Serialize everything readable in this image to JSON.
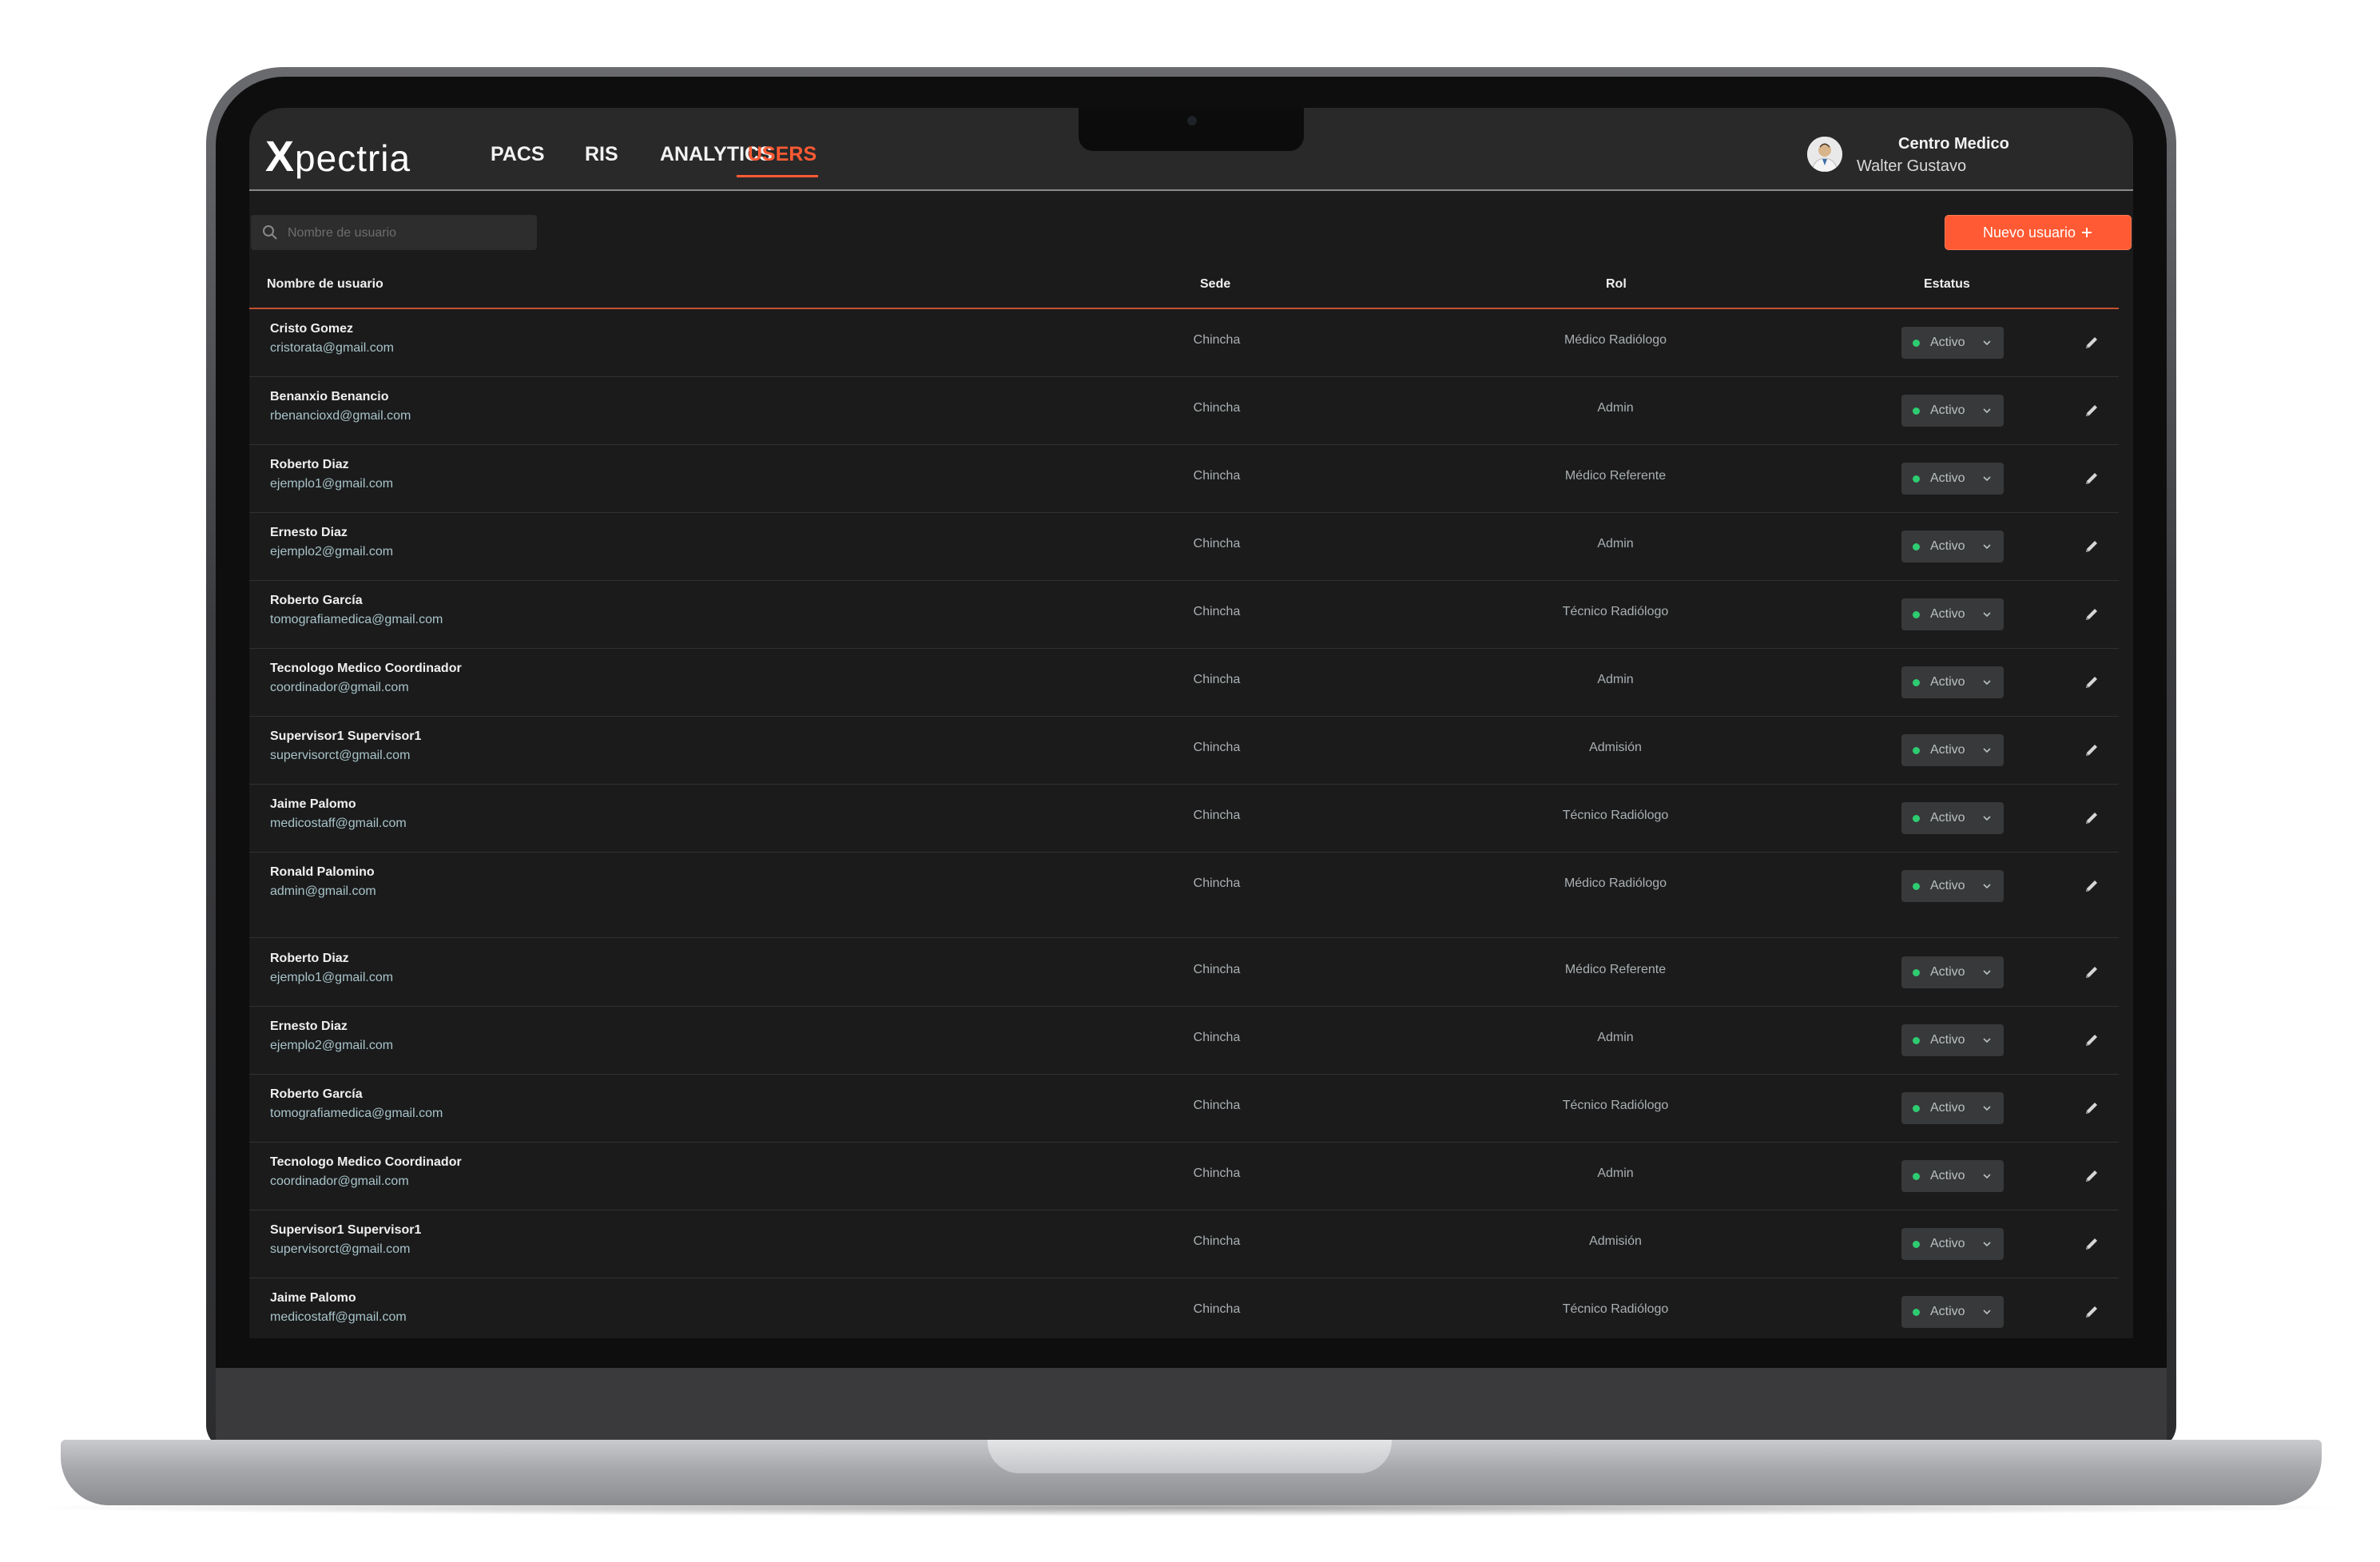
{
  "app": {
    "logo_text": "pectria",
    "logo_mark": "X"
  },
  "nav": [
    {
      "label": "PACS",
      "active": false
    },
    {
      "label": "RIS",
      "active": false
    },
    {
      "label": "ANALYTICS",
      "active": false
    },
    {
      "label": "USERS",
      "active": true
    }
  ],
  "user": {
    "organization": "Centro Medico",
    "name": "Walter Gustavo"
  },
  "search": {
    "placeholder": "Nombre de usuario",
    "value": ""
  },
  "new_user_button": {
    "label": "Nuevo usuario",
    "icon": "plus-icon"
  },
  "table": {
    "headers": {
      "name": "Nombre de usuario",
      "sede": "Sede",
      "rol": "Rol",
      "status": "Estatus"
    },
    "rows": [
      {
        "name": "Cristo Gomez",
        "email": "cristorata@gmail.com",
        "sede": "Chincha",
        "rol": "Médico Radiólogo",
        "status": "Activo"
      },
      {
        "name": "Benanxio Benancio",
        "email": "rbenancioxd@gmail.com",
        "sede": "Chincha",
        "rol": "Admin",
        "status": "Activo"
      },
      {
        "name": "Roberto Diaz",
        "email": "ejemplo1@gmail.com",
        "sede": "Chincha",
        "rol": "Médico Referente",
        "status": "Activo"
      },
      {
        "name": "Ernesto Diaz",
        "email": "ejemplo2@gmail.com",
        "sede": "Chincha",
        "rol": "Admin",
        "status": "Activo"
      },
      {
        "name": "Roberto García",
        "email": "tomografiamedica@gmail.com",
        "sede": "Chincha",
        "rol": "Técnico Radiólogo",
        "status": "Activo"
      },
      {
        "name": "Tecnologo Medico Coordinador",
        "email": "coordinador@gmail.com",
        "sede": "Chincha",
        "rol": "Admin",
        "status": "Activo"
      },
      {
        "name": "Supervisor1 Supervisor1",
        "email": "supervisorct@gmail.com",
        "sede": "Chincha",
        "rol": "Admisión",
        "status": "Activo"
      },
      {
        "name": "Jaime Palomo",
        "email": "medicostaff@gmail.com",
        "sede": "Chincha",
        "rol": "Técnico Radiólogo",
        "status": "Activo"
      },
      {
        "name": "Ronald Palomino",
        "email": "admin@gmail.com",
        "sede": "Chincha",
        "rol": "Médico Radiólogo",
        "status": "Activo"
      },
      {
        "name": "Roberto Diaz",
        "email": "ejemplo1@gmail.com",
        "sede": "Chincha",
        "rol": "Médico Referente",
        "status": "Activo"
      },
      {
        "name": "Ernesto Diaz",
        "email": "ejemplo2@gmail.com",
        "sede": "Chincha",
        "rol": "Admin",
        "status": "Activo"
      },
      {
        "name": "Roberto García",
        "email": "tomografiamedica@gmail.com",
        "sede": "Chincha",
        "rol": "Técnico Radiólogo",
        "status": "Activo"
      },
      {
        "name": "Tecnologo Medico Coordinador",
        "email": "coordinador@gmail.com",
        "sede": "Chincha",
        "rol": "Admin",
        "status": "Activo"
      },
      {
        "name": "Supervisor1 Supervisor1",
        "email": "supervisorct@gmail.com",
        "sede": "Chincha",
        "rol": "Admisión",
        "status": "Activo"
      },
      {
        "name": "Jaime Palomo",
        "email": "medicostaff@gmail.com",
        "sede": "Chincha",
        "rol": "Técnico Radiólogo",
        "status": "Activo"
      }
    ]
  },
  "colors": {
    "accent": "#ff5a33",
    "status_active": "#2ecc71",
    "background": "#1b1b1c",
    "topbar": "#29292a"
  },
  "icons": {
    "search": "search-icon",
    "status_dropdown": "chevron-down-icon",
    "edit": "pencil-icon",
    "avatar": "avatar-icon"
  }
}
